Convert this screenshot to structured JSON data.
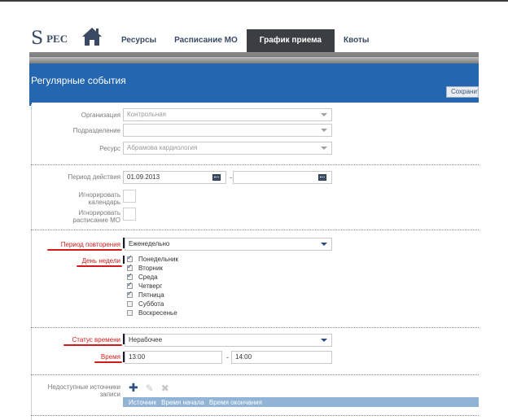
{
  "app": {
    "logo_glyph": "S",
    "logo_text": "РЕС",
    "home_icon": "home-icon"
  },
  "nav": {
    "items": [
      {
        "label": "Ресурсы",
        "active": false
      },
      {
        "label": "Расписание МО",
        "active": false
      },
      {
        "label": "График приема",
        "active": true
      },
      {
        "label": "Квоты",
        "active": false
      }
    ]
  },
  "banner": {
    "title": "Регулярные события",
    "save_label": "Сохранить"
  },
  "section1": {
    "organization_label": "Организация",
    "organization_value": "Контрольная",
    "department_label": "Подразделение",
    "department_value": "",
    "resource_label": "Ресурс",
    "resource_value": "Абрамова кардиология"
  },
  "section2": {
    "period_label": "Период действия",
    "period_from": "01.09.2013",
    "period_to": "",
    "dash": "-",
    "ignore_calendar_label_1": "Игнорировать",
    "ignore_calendar_label_2": "календарь",
    "ignore_schedule_label_1": "Игнорировать",
    "ignore_schedule_label_2": "расписание МО"
  },
  "section3": {
    "repeat_label": "Период повторения",
    "repeat_value": "Еженедельно",
    "weekday_label": "День недели",
    "weekdays": [
      {
        "label": "Понедельник",
        "checked": true
      },
      {
        "label": "Вторник",
        "checked": true
      },
      {
        "label": "Среда",
        "checked": true
      },
      {
        "label": "Четверг",
        "checked": true
      },
      {
        "label": "Пятница",
        "checked": true
      },
      {
        "label": "Суббота",
        "checked": false
      },
      {
        "label": "Воскресенье",
        "checked": false
      }
    ]
  },
  "section4": {
    "status_label": "Статус времени",
    "status_value": "Нерабочее",
    "time_label": "Время",
    "time_from": "13:00",
    "time_to": "14:00",
    "dash": "-"
  },
  "section5": {
    "sources_label_1": "Недоступные источники",
    "sources_label_2": "записи",
    "toolbar": [
      "add-icon",
      "edit-icon",
      "delete-icon"
    ],
    "columns": [
      "Источник",
      "Время начала",
      "Время окончания"
    ]
  },
  "colors": {
    "banner": "#2566b0",
    "nav_active": "#3b3e43",
    "required_label": "#d21b1b",
    "grid_header": "#90b3d6"
  }
}
